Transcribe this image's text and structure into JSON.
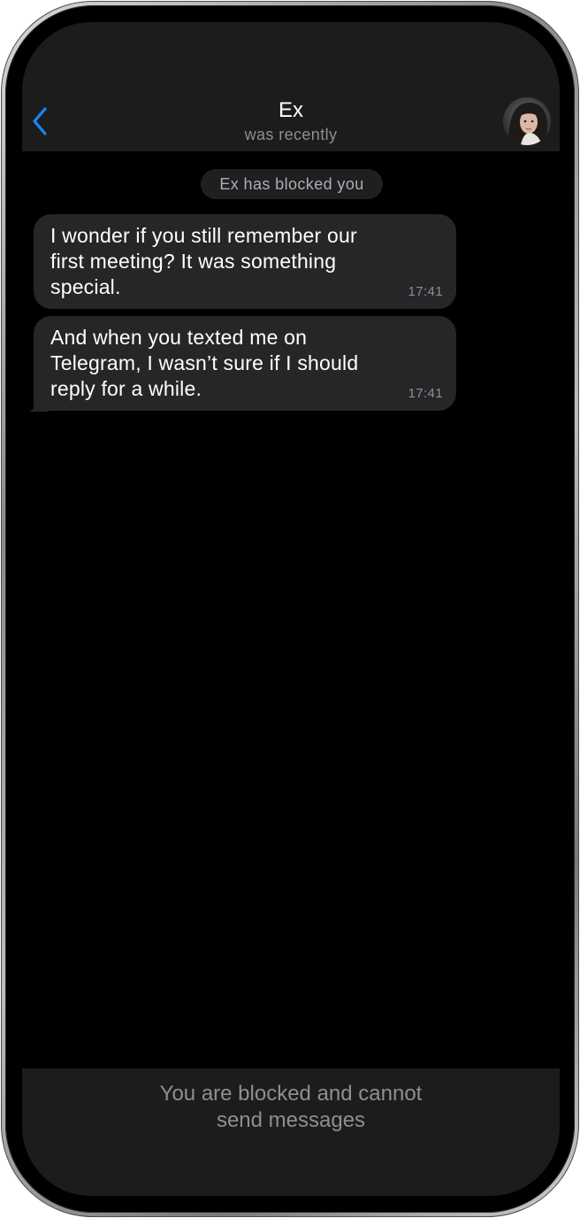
{
  "header": {
    "back_icon": "chevron-left-icon",
    "title": "Ex",
    "subtitle": "was recently",
    "accent_color": "#1a84ff"
  },
  "service_message": "Ex has blocked you",
  "messages": [
    {
      "text": "I wonder if you still remember our\nfirst meeting? It was something\nspecial.",
      "time": "17:41"
    },
    {
      "text": "And when you texted me on\nTelegram, I wasn’t sure if I should\nreply for a while.",
      "time": "17:41"
    }
  ],
  "composer": {
    "blocked_text": "You are blocked and cannot\nsend messages"
  },
  "colors": {
    "background": "#000000",
    "bar": "#1c1c1d",
    "bubble": "#262628",
    "secondary_text": "#8e8e93"
  }
}
